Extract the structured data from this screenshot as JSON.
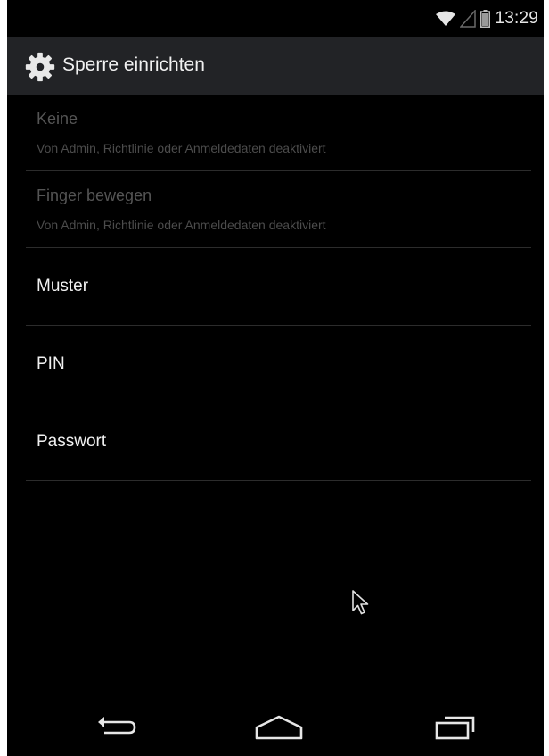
{
  "status_bar": {
    "time": "13:29",
    "icons": [
      "wifi-icon",
      "signal-icon",
      "battery-icon"
    ]
  },
  "action_bar": {
    "icon": "gear-icon",
    "title": "Sperre einrichten"
  },
  "items": [
    {
      "title": "Keine",
      "summary": "Von Admin, Richtlinie oder Anmeldedaten deaktiviert",
      "enabled": false
    },
    {
      "title": "Finger bewegen",
      "summary": "Von Admin, Richtlinie oder Anmeldedaten deaktiviert",
      "enabled": false
    },
    {
      "title": "Muster",
      "enabled": true
    },
    {
      "title": "PIN",
      "enabled": true
    },
    {
      "title": "Passwort",
      "enabled": true
    }
  ],
  "nav_bar": {
    "buttons": [
      "back-icon",
      "home-icon",
      "recents-icon"
    ]
  },
  "colors": {
    "background": "#000000",
    "action_bar": "#222326",
    "text_enabled": "#f0f0f0",
    "text_disabled": "#555555",
    "divider": "#2c2c2c"
  }
}
